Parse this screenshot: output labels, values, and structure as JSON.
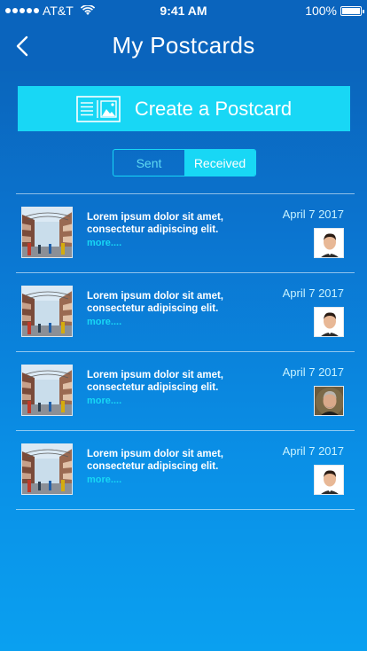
{
  "status_bar": {
    "carrier": "AT&T",
    "time": "9:41 AM",
    "battery": "100%"
  },
  "nav": {
    "title": "My Postcards",
    "back_icon": "chevron-left-icon"
  },
  "create_button": {
    "label": "Create a Postcard",
    "icon": "postcard-icon"
  },
  "segment": {
    "sent_label": "Sent",
    "received_label": "Received",
    "selected": "Received"
  },
  "postcards": [
    {
      "body": "Lorem ipsum dolor sit amet, consectetur adipiscing elit.",
      "more": "more....",
      "date": "April 7 2017",
      "avatar_style": "dark-hair"
    },
    {
      "body": "Lorem ipsum dolor sit amet, consectetur adipiscing elit.",
      "more": "more....",
      "date": "April 7 2017",
      "avatar_style": "dark-hair"
    },
    {
      "body": "Lorem ipsum dolor sit amet, consectetur adipiscing elit.",
      "more": "more....",
      "date": "April 7 2017",
      "avatar_style": "gray-hair"
    },
    {
      "body": "Lorem ipsum dolor sit amet, consectetur adipiscing elit.",
      "more": "more....",
      "date": "April 7 2017",
      "avatar_style": "dark-hair"
    }
  ],
  "colors": {
    "nav_background": "#0a64bd",
    "accent": "#18d7f5",
    "date_text": "#c9f3ff"
  }
}
